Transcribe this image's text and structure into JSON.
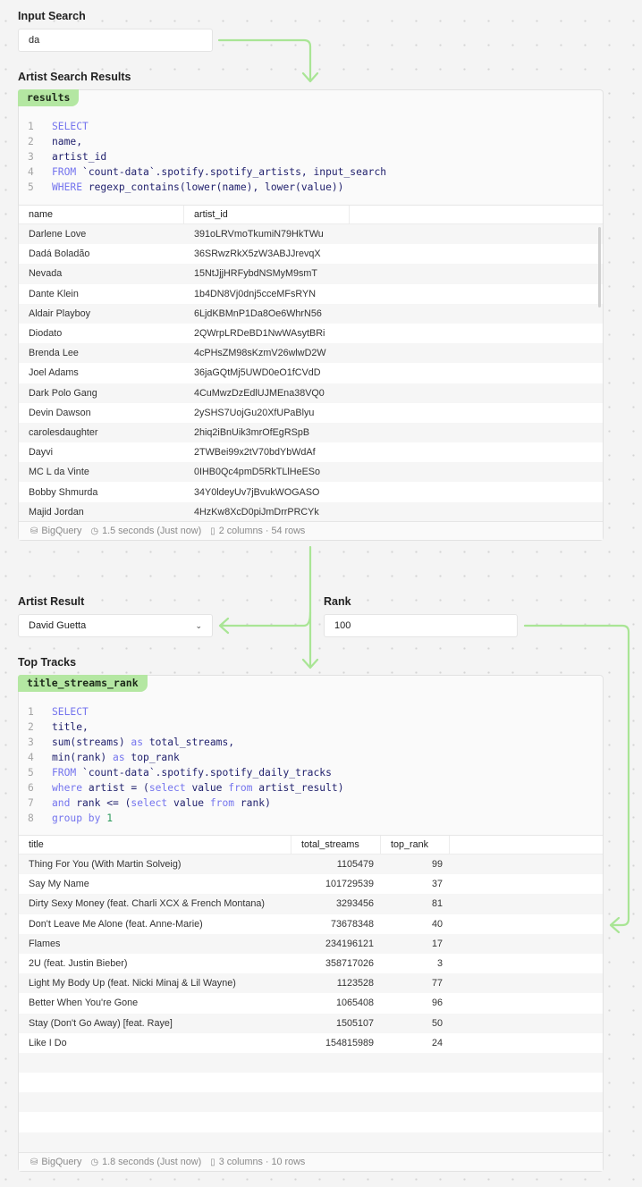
{
  "input_search": {
    "label": "Input Search",
    "value": "da"
  },
  "artist_search": {
    "label": "Artist Search Results",
    "tag": "results",
    "code": [
      [
        [
          "SELECT",
          "kw"
        ]
      ],
      [
        [
          "name,",
          "id"
        ]
      ],
      [
        [
          "artist_id",
          "id"
        ]
      ],
      [
        [
          "FROM",
          "kw"
        ],
        [
          " `count-data`.spotify.spotify_artists, input_search",
          "id"
        ]
      ],
      [
        [
          "WHERE",
          "kw"
        ],
        [
          " regexp_contains(lower(name), lower(value))",
          "id"
        ]
      ]
    ],
    "columns": [
      "name",
      "artist_id"
    ],
    "rows": [
      [
        "Darlene Love",
        "391oLRVmoTkumiN79HkTWu"
      ],
      [
        "Dadá Boladão",
        "36SRwzRkX5zW3ABJJrevqX"
      ],
      [
        "Nevada",
        "15NtJjjHRFybdNSMyM9smT"
      ],
      [
        "Dante Klein",
        "1b4DN8Vj0dnj5cceMFsRYN"
      ],
      [
        "Aldair Playboy",
        "6LjdKBMnP1Da8Oe6WhrN56"
      ],
      [
        "Diodato",
        "2QWrpLRDeBD1NwWAsytBRi"
      ],
      [
        "Brenda Lee",
        "4cPHsZM98sKzmV26wlwD2W"
      ],
      [
        "Joel Adams",
        "36jaGQtMj5UWD0eO1fCVdD"
      ],
      [
        "Dark Polo Gang",
        "4CuMwzDzEdlUJMEna38VQ0"
      ],
      [
        "Devin Dawson",
        "2ySHS7UojGu20XfUPaBlyu"
      ],
      [
        "carolesdaughter",
        "2hiq2iBnUik3mrOfEgRSpB"
      ],
      [
        "Dayvi",
        "2TWBei99x2tV70bdYbWdAf"
      ],
      [
        "MC L da Vinte",
        "0IHB0Qc4pmD5RkTLlHeESo"
      ],
      [
        "Bobby Shmurda",
        "34Y0ldeyUv7jBvukWOGASO"
      ],
      [
        "Majid Jordan",
        "4HzKw8XcD0piJmDrrPRCYk"
      ]
    ],
    "footer": {
      "source": "BigQuery",
      "time": "1.5 seconds (Just now)",
      "shape": "2 columns · 54 rows"
    }
  },
  "artist_result": {
    "label": "Artist Result",
    "value": "David Guetta"
  },
  "rank": {
    "label": "Rank",
    "value": "100"
  },
  "top_tracks": {
    "label": "Top Tracks",
    "tag": "title_streams_rank",
    "code": [
      [
        [
          "SELECT",
          "kw"
        ]
      ],
      [
        [
          "title,",
          "id"
        ]
      ],
      [
        [
          "sum(streams) ",
          "id"
        ],
        [
          "as",
          "kw"
        ],
        [
          " total_streams,",
          "id"
        ]
      ],
      [
        [
          "min(rank) ",
          "id"
        ],
        [
          "as",
          "kw"
        ],
        [
          " top_rank",
          "id"
        ]
      ],
      [
        [
          "FROM",
          "kw"
        ],
        [
          " `count-data`.spotify.spotify_daily_tracks",
          "id"
        ]
      ],
      [
        [
          "where",
          "kw"
        ],
        [
          " artist = (",
          "id"
        ],
        [
          "select",
          "kw"
        ],
        [
          " value ",
          "id"
        ],
        [
          "from",
          "kw"
        ],
        [
          " artist_result)",
          "id"
        ]
      ],
      [
        [
          "and",
          "kw"
        ],
        [
          " rank <= (",
          "id"
        ],
        [
          "select",
          "kw"
        ],
        [
          " value ",
          "id"
        ],
        [
          "from",
          "kw"
        ],
        [
          " rank)",
          "id"
        ]
      ],
      [
        [
          "group by",
          "kw"
        ],
        [
          " ",
          "id"
        ],
        [
          "1",
          "num"
        ]
      ]
    ],
    "columns": [
      "title",
      "total_streams",
      "top_rank"
    ],
    "rows": [
      [
        "Thing For You (With Martin Solveig)",
        "1105479",
        "99"
      ],
      [
        "Say My Name",
        "101729539",
        "37"
      ],
      [
        "Dirty Sexy Money (feat. Charli XCX & French Montana)",
        "3293456",
        "81"
      ],
      [
        "Don't Leave Me Alone (feat. Anne-Marie)",
        "73678348",
        "40"
      ],
      [
        "Flames",
        "234196121",
        "17"
      ],
      [
        "2U (feat. Justin Bieber)",
        "358717026",
        "3"
      ],
      [
        "Light My Body Up (feat. Nicki Minaj & Lil Wayne)",
        "1123528",
        "77"
      ],
      [
        "Better When You're Gone",
        "1065408",
        "96"
      ],
      [
        "Stay (Don't Go Away) [feat. Raye]",
        "1505107",
        "50"
      ],
      [
        "Like I Do",
        "154815989",
        "24"
      ]
    ],
    "footer": {
      "source": "BigQuery",
      "time": "1.8 seconds (Just now)",
      "shape": "3 columns · 10 rows"
    }
  },
  "colors": {
    "accent": "#b4e7a2",
    "keyword": "#7474ee"
  }
}
